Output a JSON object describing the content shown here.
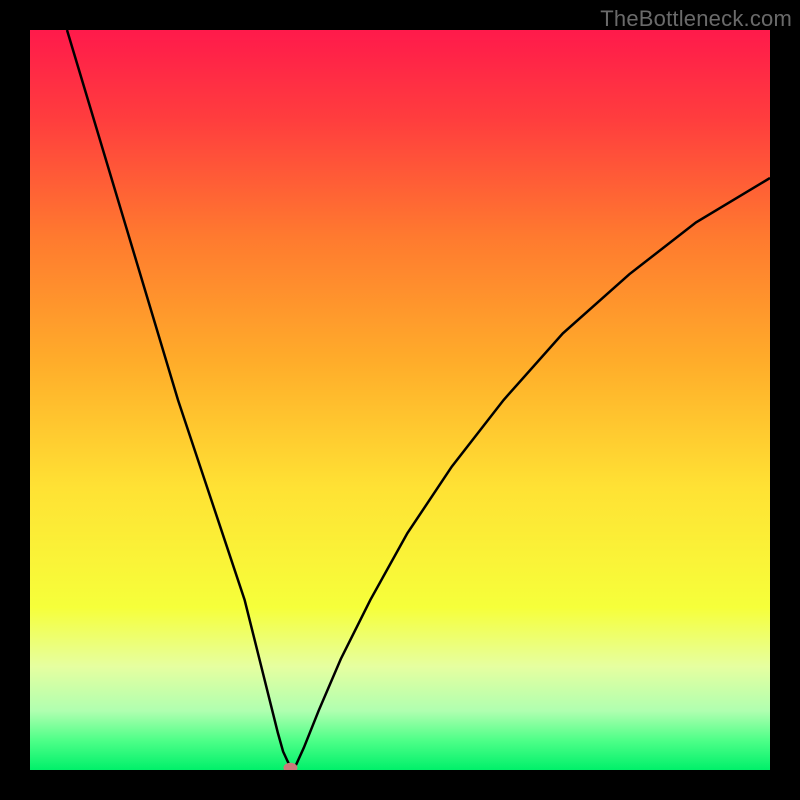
{
  "watermark": "TheBottleneck.com",
  "chart_data": {
    "type": "line",
    "title": "",
    "xlabel": "",
    "ylabel": "",
    "xlim": [
      0,
      100
    ],
    "ylim": [
      0,
      100
    ],
    "background_gradient": {
      "stops": [
        {
          "offset": 0.0,
          "color": "#ff1a4b"
        },
        {
          "offset": 0.12,
          "color": "#ff3d3e"
        },
        {
          "offset": 0.28,
          "color": "#ff7a2f"
        },
        {
          "offset": 0.45,
          "color": "#ffad2a"
        },
        {
          "offset": 0.62,
          "color": "#ffe234"
        },
        {
          "offset": 0.78,
          "color": "#f6ff3a"
        },
        {
          "offset": 0.86,
          "color": "#e6ffa0"
        },
        {
          "offset": 0.92,
          "color": "#b0ffb0"
        },
        {
          "offset": 0.96,
          "color": "#4eff88"
        },
        {
          "offset": 1.0,
          "color": "#00f06a"
        }
      ]
    },
    "series": [
      {
        "name": "bottleneck-curve",
        "color": "#000000",
        "x": [
          5,
          8,
          11,
          14,
          17,
          20,
          23,
          26,
          29,
          31,
          32.5,
          33.5,
          34.2,
          34.8,
          35.2,
          35.5,
          36,
          37,
          39,
          42,
          46,
          51,
          57,
          64,
          72,
          81,
          90,
          100
        ],
        "values": [
          100,
          90,
          80,
          70,
          60,
          50,
          41,
          32,
          23,
          15,
          9,
          5,
          2.5,
          1.2,
          0.4,
          0.1,
          0.8,
          3,
          8,
          15,
          23,
          32,
          41,
          50,
          59,
          67,
          74,
          80
        ]
      }
    ],
    "marker": {
      "name": "optimum-point",
      "x": 35.2,
      "y": 0.3,
      "color": "#c97a7a",
      "rx": 7,
      "ry": 5
    }
  }
}
